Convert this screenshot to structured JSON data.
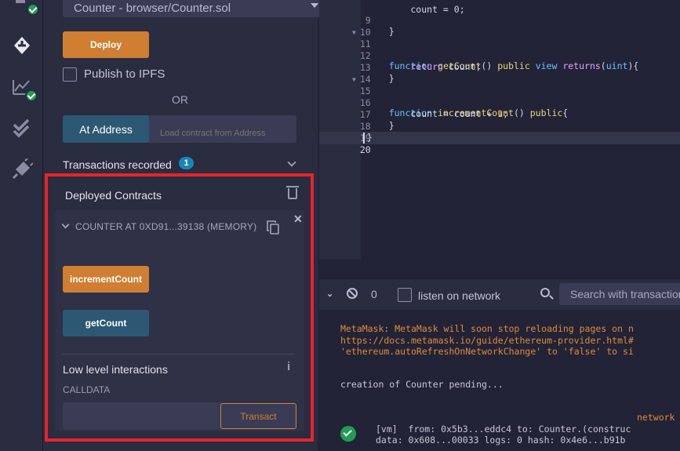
{
  "deploy_panel": {
    "contract_select": "Counter - browser/Counter.sol",
    "deploy_label": "Deploy",
    "publish_ipfs_label": "Publish to IPFS",
    "or_label": "OR",
    "at_address_label": "At Address",
    "at_address_placeholder": "Load contract from Address",
    "transactions_recorded_label": "Transactions recorded",
    "transactions_recorded_count": "1",
    "deployed_contracts_title": "Deployed Contracts",
    "instance_label": "COUNTER AT 0XD91...39138 (MEMORY)",
    "functions": [
      {
        "label": "incrementCount",
        "color": "#d07f32"
      },
      {
        "label": "getCount",
        "color": "#2d5873"
      }
    ],
    "low_level_title": "Low level interactions",
    "calldata_label": "CALLDATA",
    "transact_label": "Transact"
  },
  "editor": {
    "lines": [
      {
        "n": "9",
        "text": "    }"
      },
      {
        "n": "10",
        "text": ""
      },
      {
        "n": "11",
        "text": "    function getCount() public view returns(uint)",
        "fold": true
      },
      {
        "n": "12",
        "text": "        return count;"
      },
      {
        "n": "13",
        "text": "    }"
      },
      {
        "n": "14",
        "text": ""
      },
      {
        "n": "15",
        "text": "    function incrementCount() public{",
        "fold": true
      },
      {
        "n": "16",
        "text": "        count = count + 1;"
      },
      {
        "n": "17",
        "text": "    }"
      },
      {
        "n": "18",
        "text": "}"
      },
      {
        "n": "19",
        "text": ""
      },
      {
        "n": "20",
        "text": ""
      }
    ],
    "top_partial": "        count = 0;"
  },
  "terminal": {
    "pending_count": "0",
    "listen_label": "listen on network",
    "search_placeholder": "Search with transaction hash or address",
    "metamask_lines": [
      "MetaMask: MetaMask will soon stop reloading pages on n",
      "https://docs.metamask.io/guide/ethereum-provider.html#",
      "'ethereum.autoRefreshOnNetworkChange' to 'false' to si"
    ],
    "pending_line": "creation of Counter pending...",
    "vm_line": "[vm]  from: 0x5b3...eddc4 to: Counter.(construc",
    "data_line": "data: 0x608...00033 logs: 0 hash: 0x4e6...b91b",
    "network_label": "network"
  }
}
